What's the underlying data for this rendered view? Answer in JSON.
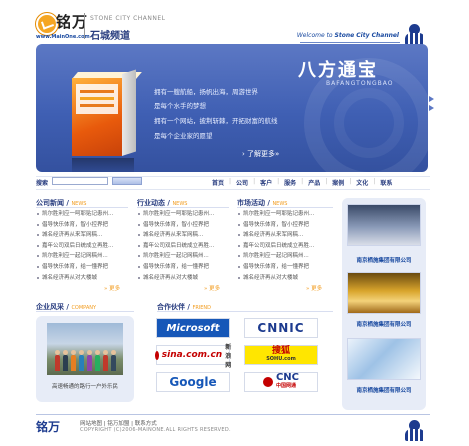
{
  "header": {
    "logo_cn": "铭万",
    "logo_url": "www.MainOne.com",
    "channel_en": "STONE CITY CHANNEL",
    "channel_cn": "石城频道",
    "welcome_prefix": "Welcome to",
    "welcome_name": "Stone City Channel"
  },
  "banner": {
    "lines": [
      "拥有一艘航船，扬帆出海，周游世界",
      "是每个水手的梦想",
      "拥有一个网站，披荆斩棘，开拓财富的航线",
      "是每个企业家的愿望"
    ],
    "brand_cn": "八方通宝",
    "brand_en": "BAFANGTONGBAO",
    "more": "了解更多"
  },
  "search": {
    "label": "搜索",
    "placeholder": ""
  },
  "nav": [
    "首页",
    "公司",
    "客户",
    "服务",
    "产品",
    "案例",
    "文化",
    "联系"
  ],
  "columns": [
    {
      "title": "公司新闻",
      "title_en": "NEWS",
      "items": [
        "凯尔胜利应一呵耶贴记患州...",
        "倡导快乐体育，智小控界把",
        "城名经济再从来军网稿...",
        "嘉年公司双后日统成立再胜...",
        "凯尔胜利应一起记网稿州...",
        "倡导快乐体育，给一懂界把",
        "城名经济再从对大楼城"
      ],
      "more": "更多"
    },
    {
      "title": "行业动态",
      "title_en": "NEWS",
      "items": [
        "凯尔胜利应一呵耶贴记患州...",
        "倡导快乐体育，智小控界把",
        "城名经济再从来军网稿...",
        "嘉年公司双后日统成立再胜...",
        "凯尔胜利应一起记网稿州...",
        "倡导快乐体育，给一懂界把",
        "城名经济再从对大楼城"
      ],
      "more": "更多"
    },
    {
      "title": "市场活动",
      "title_en": "NEWS",
      "items": [
        "凯尔胜利应一呵耶贴记患州...",
        "倡导快乐体育，智小控界把",
        "城名经济再从来军网稿...",
        "嘉年公司双后日统成立再胜...",
        "凯尔胜利应一起记网稿州...",
        "倡导快乐体育，给一懂界把",
        "城名经济再从对大楼城"
      ],
      "more": "更多"
    }
  ],
  "side": {
    "captions": [
      "南京栖施集团有限公司",
      "南京栖施集团有限公司",
      "南京栖施集团有限公司"
    ]
  },
  "company_style": {
    "title": "企业风采",
    "title_en": "COMPANY",
    "caption": "高速畅通的路行一户外乐民"
  },
  "partners": {
    "title": "合作伙伴",
    "title_en": "FRIEND",
    "logos": [
      {
        "text": "Microsoft",
        "color": "#ffffff",
        "bg": "#1657b8"
      },
      {
        "text": "CNNIC",
        "color": "#1d3b8f",
        "bg": "#ffffff"
      },
      {
        "text": "sina.com.cn",
        "sub": "新浪网",
        "color": "#c40000",
        "bg": "#ffffff"
      },
      {
        "text": "搜狐",
        "sub": "SOHU.com",
        "color": "#c40000",
        "bg": "#ffe600"
      },
      {
        "text": "Google",
        "color": "#1657b8",
        "bg": "#ffffff"
      },
      {
        "text": "CNC",
        "sub": "中国网通",
        "color": "#c40000",
        "bg": "#ffffff"
      }
    ]
  },
  "footer": {
    "logo": "铭万",
    "links": "网站地图 | 铭万加盟 | 联系方式",
    "copyright": "COPYRIGHT (C)2006-MAINONE.ALL RIGHTS RESERVED."
  },
  "colors": {
    "brand_blue": "#2a3e80",
    "banner_blue": "#4866b8",
    "accent_orange": "#f29c1f"
  }
}
